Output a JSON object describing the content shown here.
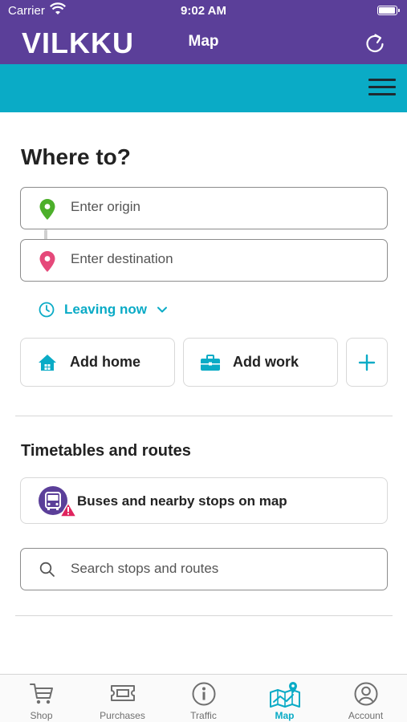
{
  "status_bar": {
    "carrier": "Carrier",
    "time": "9:02 AM",
    "battery_level": 1.0
  },
  "app_bar": {
    "brand": "VILKKU",
    "title": "Map",
    "refresh_icon": "refresh-icon"
  },
  "sub_bar": {
    "menu_icon": "hamburger-menu-icon"
  },
  "trip": {
    "heading": "Where to?",
    "origin": {
      "value": "",
      "placeholder": "Enter origin",
      "icon": "origin-pin-icon",
      "color": "#4caf2a"
    },
    "destination": {
      "value": "",
      "placeholder": "Enter destination",
      "icon": "destination-pin-icon",
      "color": "#e5497a"
    },
    "leaving": "Leaving now",
    "shortcuts": [
      {
        "label": "Add home",
        "icon": "home-icon"
      },
      {
        "label": "Add work",
        "icon": "briefcase-icon"
      }
    ],
    "add_icon": "plus-icon"
  },
  "timetables": {
    "title": "Timetables and routes",
    "buses_label": "Buses and nearby stops on map",
    "search": {
      "value": "",
      "placeholder": "Search stops and routes"
    }
  },
  "tabs": [
    {
      "label": "Shop",
      "icon": "cart-icon",
      "active": false
    },
    {
      "label": "Purchases",
      "icon": "ticket-icon",
      "active": false
    },
    {
      "label": "Traffic",
      "icon": "info-icon",
      "active": false
    },
    {
      "label": "Map",
      "icon": "map-icon",
      "active": true
    },
    {
      "label": "Account",
      "icon": "account-icon",
      "active": false
    }
  ],
  "colors": {
    "header": "#5b3f99",
    "accent": "#0aabc6",
    "warning": "#e0245e"
  }
}
